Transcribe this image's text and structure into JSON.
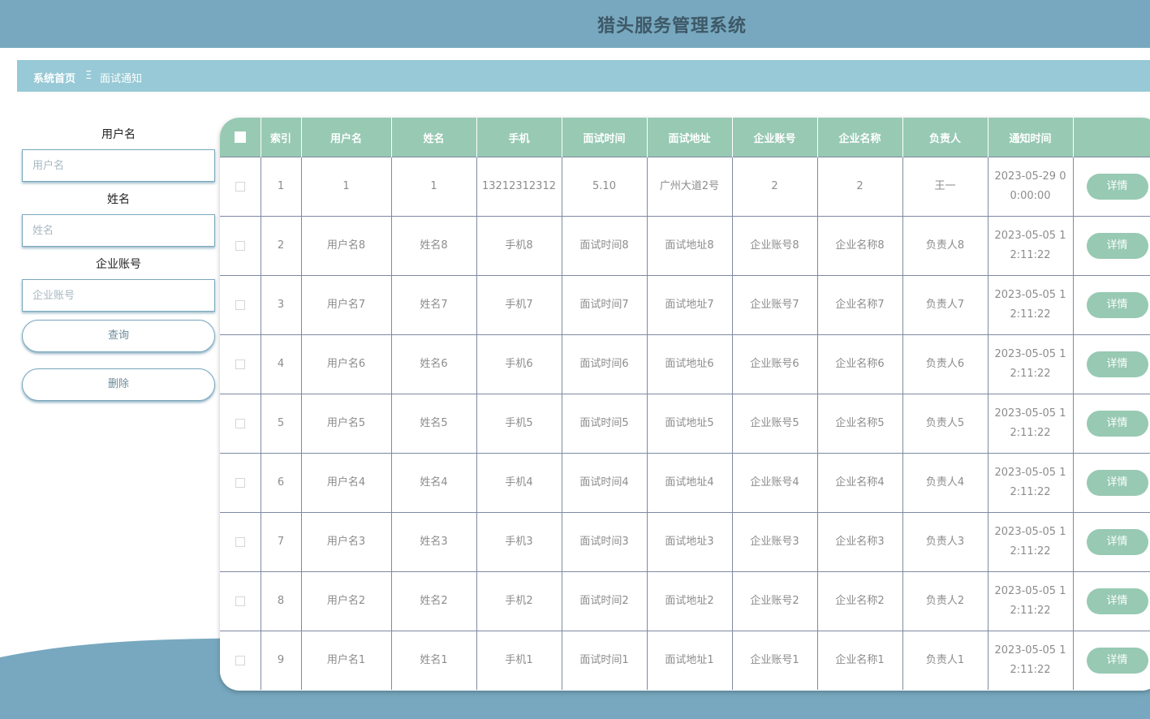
{
  "header": {
    "title": "猎头服务管理系统"
  },
  "breadcrumb": {
    "home": "系统首页",
    "separator": "Ξ",
    "current": "面试通知"
  },
  "search": {
    "fields": [
      {
        "label": "用户名",
        "placeholder": "用户名",
        "value": ""
      },
      {
        "label": "姓名",
        "placeholder": "姓名",
        "value": ""
      },
      {
        "label": "企业账号",
        "placeholder": "企业账号",
        "value": ""
      }
    ],
    "query_button": "查询",
    "delete_button": "删除"
  },
  "table": {
    "columns": [
      "索引",
      "用户名",
      "姓名",
      "手机",
      "面试时间",
      "面试地址",
      "企业账号",
      "企业名称",
      "负责人",
      "通知时间"
    ],
    "detail_label": "详情",
    "rows": [
      [
        "1",
        "1",
        "1",
        "13212312312",
        "5.10",
        "广州大道2号",
        "2",
        "2",
        "王一",
        "2023-05-29 00:00:00"
      ],
      [
        "2",
        "用户名8",
        "姓名8",
        "手机8",
        "面试时间8",
        "面试地址8",
        "企业账号8",
        "企业名称8",
        "负责人8",
        "2023-05-05 12:11:22"
      ],
      [
        "3",
        "用户名7",
        "姓名7",
        "手机7",
        "面试时间7",
        "面试地址7",
        "企业账号7",
        "企业名称7",
        "负责人7",
        "2023-05-05 12:11:22"
      ],
      [
        "4",
        "用户名6",
        "姓名6",
        "手机6",
        "面试时间6",
        "面试地址6",
        "企业账号6",
        "企业名称6",
        "负责人6",
        "2023-05-05 12:11:22"
      ],
      [
        "5",
        "用户名5",
        "姓名5",
        "手机5",
        "面试时间5",
        "面试地址5",
        "企业账号5",
        "企业名称5",
        "负责人5",
        "2023-05-05 12:11:22"
      ],
      [
        "6",
        "用户名4",
        "姓名4",
        "手机4",
        "面试时间4",
        "面试地址4",
        "企业账号4",
        "企业名称4",
        "负责人4",
        "2023-05-05 12:11:22"
      ],
      [
        "7",
        "用户名3",
        "姓名3",
        "手机3",
        "面试时间3",
        "面试地址3",
        "企业账号3",
        "企业名称3",
        "负责人3",
        "2023-05-05 12:11:22"
      ],
      [
        "8",
        "用户名2",
        "姓名2",
        "手机2",
        "面试时间2",
        "面试地址2",
        "企业账号2",
        "企业名称2",
        "负责人2",
        "2023-05-05 12:11:22"
      ],
      [
        "9",
        "用户名1",
        "姓名1",
        "手机1",
        "面试时间1",
        "面试地址1",
        "企业账号1",
        "企业名称1",
        "负责人1",
        "2023-05-05 12:11:22"
      ]
    ]
  },
  "colors": {
    "topbar": "#77a8bf",
    "breadcrumb_bar": "#97c9d6",
    "table_header": "#97c9b3",
    "accent": "#97c9b3"
  }
}
